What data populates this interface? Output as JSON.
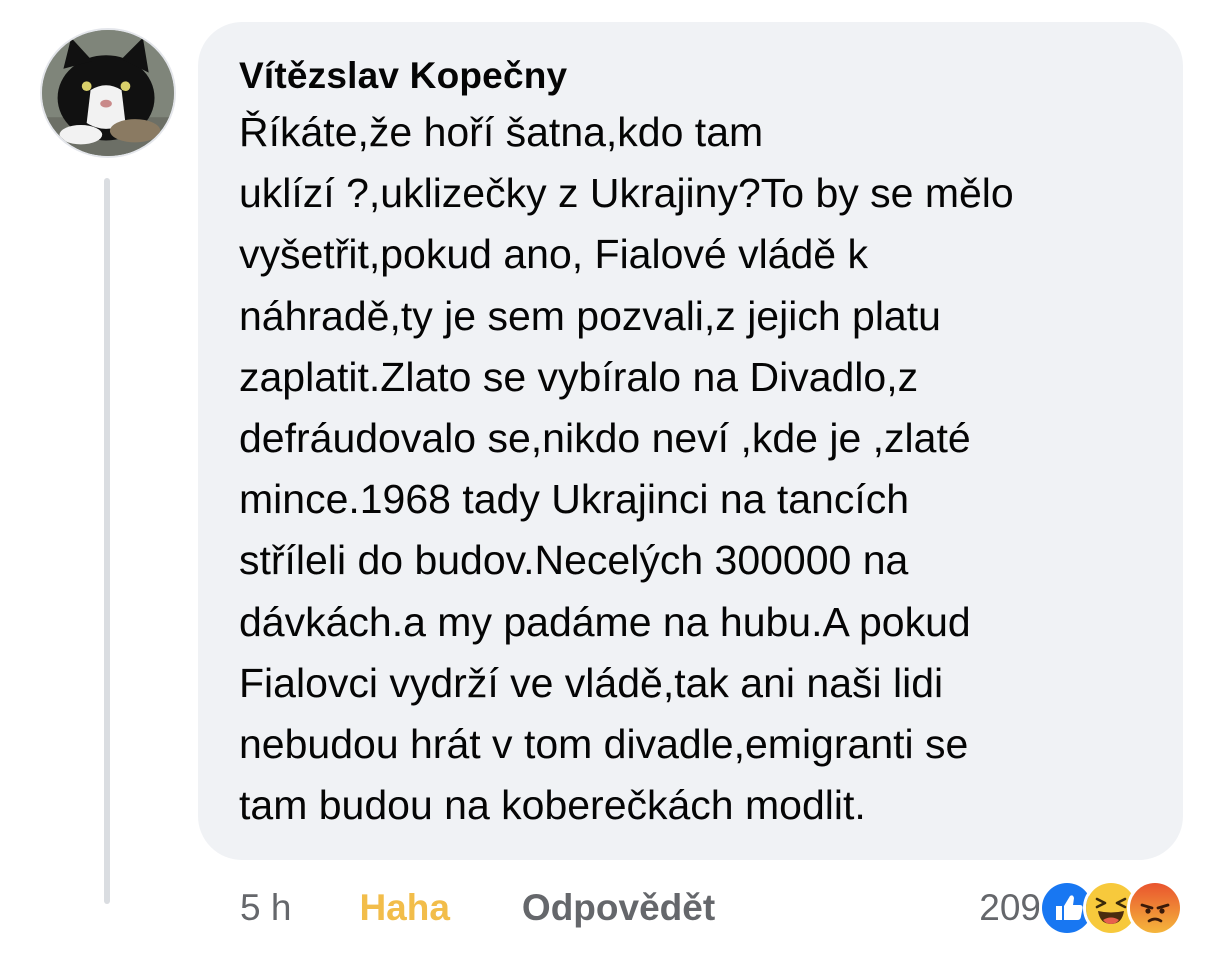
{
  "comment": {
    "author": "Vítězslav Kopečny",
    "text": "Říkáte,že hoří šatna,kdo tam\nuklízí ?,uklizečky z Ukrajiny?To by se mělo\nvyšetřit,pokud ano, Fialové vládě k\nnáhradě,ty je sem pozvali,z jejich platu\nzaplatit.Zlato se vybíralo na Divadlo,z\ndefráudovalo se,nikdo neví ,kde je ,zlaté\nmince.1968 tady Ukrajinci na tancích\nstříleli do budov.Necelých 300000 na\ndávkách.a my padáme na hubu.A pokud\nFialovci vydrží ve vládě,tak ani naši lidi\nnebudou hrát v tom divadle,emigranti se\ntam budou na koberečkách modlit.",
    "avatar_icon": "cat-avatar"
  },
  "actions": {
    "time": "5 h",
    "reaction_label": "Haha",
    "reaction_color": "#f2bd4a",
    "reply_label": "Odpovědět"
  },
  "reactions": {
    "count": "209",
    "icons": [
      "like-icon",
      "haha-icon",
      "angry-icon"
    ]
  },
  "colors": {
    "bubble": "#f0f2f5",
    "text": "#050505",
    "secondary": "#65676b",
    "like": "#1877f2"
  }
}
